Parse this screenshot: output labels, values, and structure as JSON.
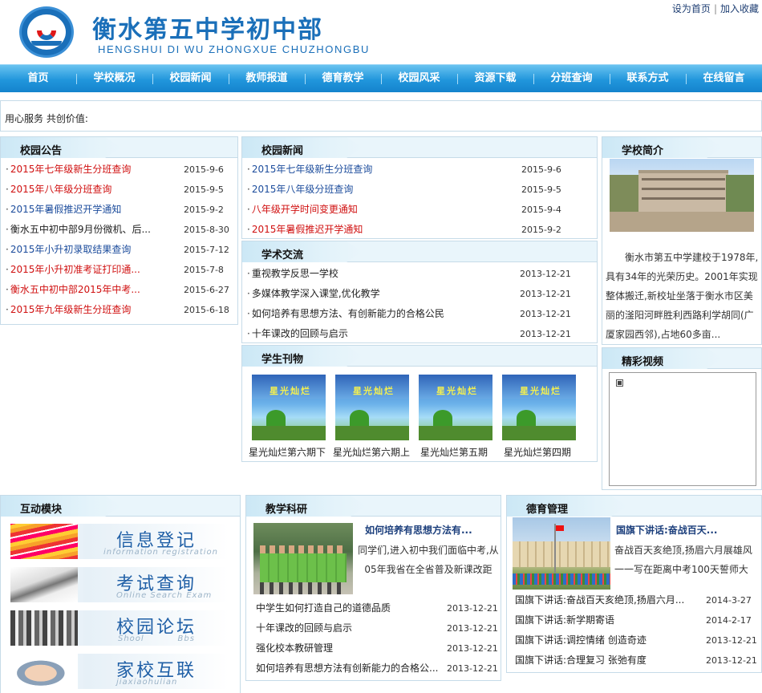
{
  "header": {
    "site_name": "衡水第五中学初中部",
    "site_pinyin": "HENGSHUI DI WU ZHONGXUE CHUZHONGBU",
    "links": [
      "设为首页",
      "加入收藏"
    ],
    "link_sep": "|"
  },
  "nav": [
    "首页",
    "学校概况",
    "校园新闻",
    "教师报道",
    "德育教学",
    "校园风采",
    "资源下载",
    "分班查询",
    "联系方式",
    "在线留言"
  ],
  "slogan": "用心服务 共创价值:",
  "notice": {
    "title": "校园公告",
    "items": [
      {
        "text": "2015年七年级新生分班查询",
        "date": "2015-9-6",
        "color": "#d01010"
      },
      {
        "text": "2015年八年级分班查询",
        "date": "2015-9-5",
        "color": "#d01010"
      },
      {
        "text": "2015年暑假推迟开学通知",
        "date": "2015-9-2",
        "color": "#1c4c9c"
      },
      {
        "text": "衡水五中初中部9月份微机、后...",
        "date": "2015-8-30",
        "color": "#222"
      },
      {
        "text": "2015年小升初录取结果查询",
        "date": "2015-7-12",
        "color": "#1c4c9c"
      },
      {
        "text": "2015年小升初准考证打印通...",
        "date": "2015-7-8",
        "color": "#d01010"
      },
      {
        "text": "衡水五中初中部2015年中考...",
        "date": "2015-6-27",
        "color": "#d01010"
      },
      {
        "text": "2015年九年级新生分班查询",
        "date": "2015-6-18",
        "color": "#d01010"
      }
    ]
  },
  "news": {
    "title": "校园新闻",
    "items": [
      {
        "text": "2015年七年级新生分班查询",
        "date": "2015-9-6",
        "color": "#1c4c9c"
      },
      {
        "text": "2015年八年级分班查询",
        "date": "2015-9-5",
        "color": "#1c4c9c"
      },
      {
        "text": "八年级开学时间变更通知",
        "date": "2015-9-4",
        "color": "#d01010"
      },
      {
        "text": "2015年暑假推迟开学通知",
        "date": "2015-9-2",
        "color": "#d01010"
      }
    ]
  },
  "academic": {
    "title": "学术交流",
    "items": [
      {
        "text": "重视教学反思一学校",
        "date": "2013-12-21"
      },
      {
        "text": "多媒体教学深入课堂,优化教学",
        "date": "2013-12-21"
      },
      {
        "text": "如何培养有思想方法、有创新能力的合格公民",
        "date": "2013-12-21"
      },
      {
        "text": "十年课改的回顾与启示",
        "date": "2013-12-21"
      }
    ]
  },
  "magazine": {
    "title": "学生刊物",
    "cover_text": "星光灿烂",
    "items": [
      "星光灿烂第六期下",
      "星光灿烂第六期上",
      "星光灿烂第五期",
      "星光灿烂第四期"
    ]
  },
  "intro": {
    "title": "学校简介",
    "text": "衡水市第五中学建校于1978年,具有34年的光荣历史。2001年实现整体搬迁,新校址坐落于衡水市区美丽的滏阳河畔胜利西路利学胡同(广厦家园西邻),占地60多亩..."
  },
  "video": {
    "title": "精彩视频"
  },
  "interactive": {
    "title": "互动模块",
    "items": [
      {
        "cn": "信息登记",
        "en": "information registration"
      },
      {
        "cn": "考试查询",
        "en": "Online Search Exam"
      },
      {
        "cn": "校园论坛",
        "en": "Shool          Bbs"
      },
      {
        "cn": "家校互联",
        "en": "jiaxiaohulian"
      }
    ]
  },
  "research": {
    "title": "教学科研",
    "feature_title": "如何培养有思想方法有...",
    "feature_text": "同学们,进入初中我们面临中考,从05年我省在全省普及新课改距",
    "items": [
      {
        "text": "中学生如何打造自己的道德品质",
        "date": "2013-12-21"
      },
      {
        "text": "十年课改的回顾与启示",
        "date": "2013-12-21"
      },
      {
        "text": "强化校本教研管理",
        "date": "2013-12-21"
      },
      {
        "text": "如何培养有思想方法有创新能力的合格公...",
        "date": "2013-12-21"
      }
    ]
  },
  "moral": {
    "title": "德育管理",
    "feature_title": "国旗下讲话:奋战百天...",
    "feature_text": "奋战百天亥绝顶,扬眉六月展雄风一一写在距离中考100天誓师大",
    "items": [
      {
        "text": "国旗下讲话:奋战百天亥绝顶,扬眉六月...",
        "date": "2014-3-27"
      },
      {
        "text": "国旗下讲话:新学期寄语",
        "date": "2014-2-17"
      },
      {
        "text": "国旗下讲话:调控情绪 创造奇迹",
        "date": "2013-12-21"
      },
      {
        "text": "国旗下讲话:合理复习 张弛有度",
        "date": "2013-12-21"
      }
    ]
  },
  "colors": {
    "accent": "#1a6fb9",
    "nav": "#2196dc",
    "link_red": "#d01010",
    "link_blue": "#1c4c9c",
    "border": "#c6dbe8"
  }
}
